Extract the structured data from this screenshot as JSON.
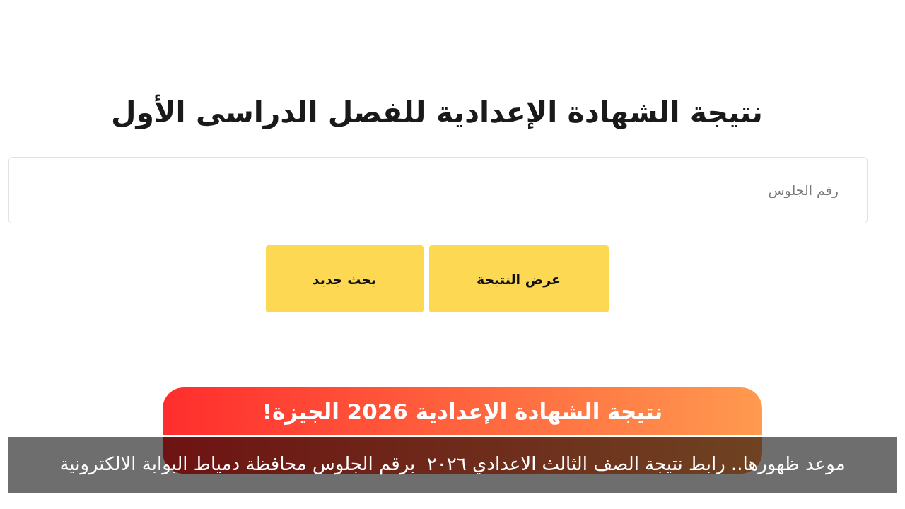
{
  "heading": "نتيجة الشهادة الإعدادية للفصل الدراسى الأول",
  "seat_number_field": {
    "placeholder": "رقم الجلوس"
  },
  "buttons": [
    "عرض النتيجة",
    "بحث جديد"
  ],
  "banner": {
    "text": "نتيجة الشهادة الإعدادية 2026 الجيزة!"
  },
  "caption": "موعد ظهورها.. رابط نتيجة الصف الثالث الاعدادي ٢٠٢٦  برقم الجلوس محافظة دمياط البوابة الالكترونية"
}
